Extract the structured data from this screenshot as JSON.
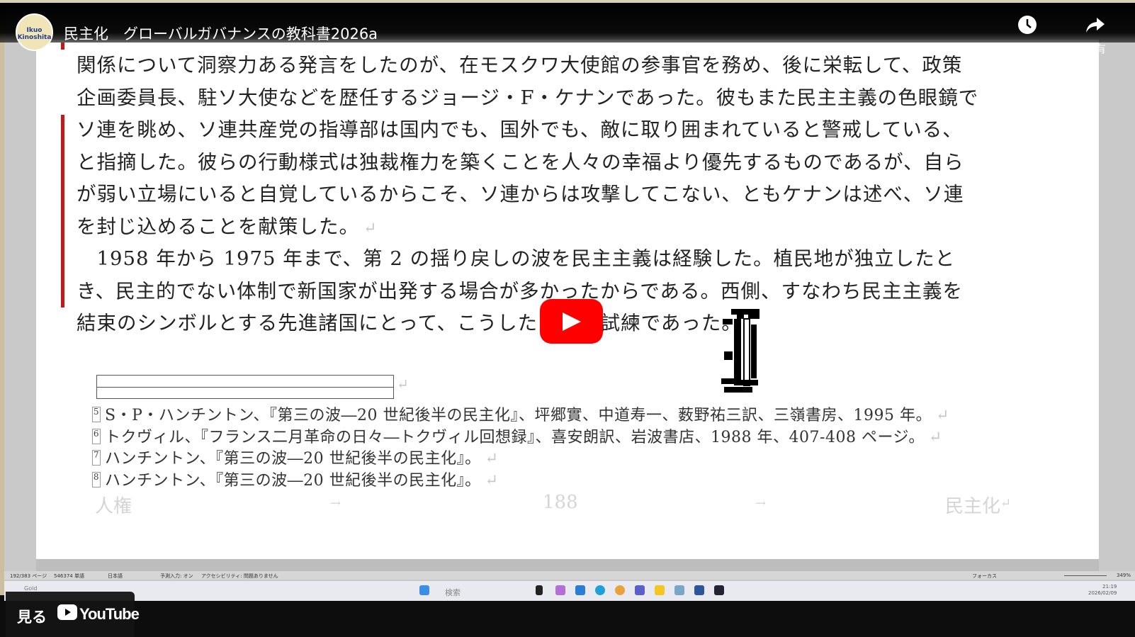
{
  "youtube": {
    "channel_avatar_text": "Ikuo Kinoshita",
    "video_title": "民主化　グローバルガバナンスの教科書2026a",
    "watch_later_label": "後で見る",
    "share_label": "共有",
    "watch_on_label": "見る",
    "youtube_wordmark": "YouTube"
  },
  "document": {
    "lines": [
      "関係について洞察力ある発言をしたのが、在モスクワ大使館の参事官を務め、後に栄転して、政策",
      "企画委員長、駐ソ大使などを歴任するジョージ・F・ケナンであった。彼もまた民主主義の色眼鏡で",
      "ソ連を眺め、ソ連共産党の指導部は国内でも、国外でも、敵に取り囲まれていると警戒している、",
      "と指摘した。彼らの行動様式は独裁権力を築くことを人々の幸福より優先するものであるが、自ら",
      "が弱い立場にいると自覚しているからこそ、ソ連からは攻撃してこない、ともケナンは述べ、ソ連",
      "を封じ込めることを献策した。",
      "　1958 年から 1975 年まで、第 2 の揺り戻しの波を民主主義は経験した。植民地が独立したと",
      "き、民主的でない体制で新国家が出発する場合が多かったからである。西側、すなわち民主主義を",
      "結束のシンボルとする先進諸国にとって、こうした",
      "は試練であった。"
    ],
    "footnotes": [
      {
        "num": "5",
        "text": "S・P・ハンチントン、『第三の波―20 世紀後半の民主化』、坪郷實、中道寿一、薮野祐三訳、三嶺書房、1995 年。"
      },
      {
        "num": "6",
        "text": "トクヴィル、『フランス二月革命の日々―トクヴィル回想録』、喜安朗訳、岩波書店、1988 年、407-408 ページ。"
      },
      {
        "num": "7",
        "text": "ハンチントン、『第三の波―20 世紀後半の民主化』。"
      },
      {
        "num": "8",
        "text": "ハンチントン、『第三の波―20 世紀後半の民主化』。"
      }
    ],
    "footer_left": "人権",
    "footer_page": "188",
    "footer_right": "民主化",
    "footer_arrow": "→",
    "return_mark": "↵"
  },
  "word_status": {
    "pages": "192/383 ページ",
    "words": "546374 単語",
    "language": "日本語",
    "input": "予測入力: オン",
    "accessibility": "アクセシビリティ: 問題ありません",
    "focus": "フォーカス",
    "zoom": "349%"
  },
  "taskbar": {
    "search_placeholder": "検索",
    "gold_label": "Gold",
    "time": "21:19",
    "date": "2026/02/09"
  },
  "colors": {
    "accent_red": "#ff0000",
    "change_bar": "#c01b1b"
  }
}
